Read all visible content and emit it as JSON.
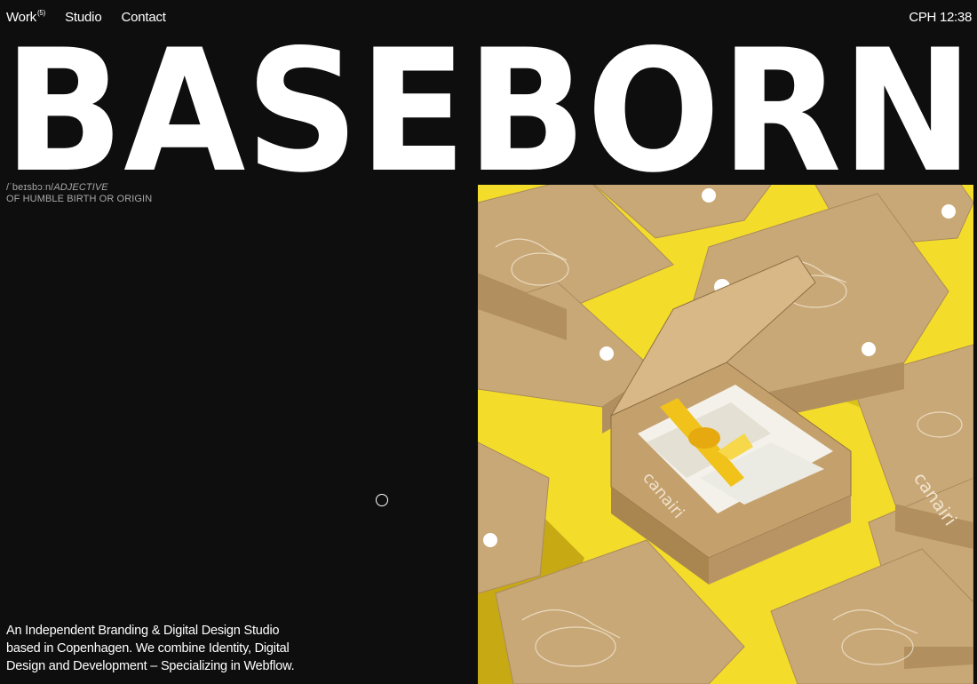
{
  "nav": {
    "items": [
      {
        "label": "Work",
        "sup": "(5)"
      },
      {
        "label": "Studio",
        "sup": ""
      },
      {
        "label": "Contact",
        "sup": ""
      }
    ],
    "clock": "CPH 12:38"
  },
  "hero": {
    "wordmark": "BASEBORN",
    "phonetic": "/ˈbeɪsbɔːn/",
    "part_of_speech": "ADJECTIVE",
    "definition": "OF HUMBLE BIRTH OR ORIGIN"
  },
  "intro": {
    "text": "An Independent Branding & Digital Design Studio based in Copenhagen. We combine Identity, Digital Design and Development – Specializing in Webflow."
  },
  "photo": {
    "brand_text": "canairi"
  },
  "colors": {
    "background": "#0e0e0e",
    "text": "#ffffff",
    "muted": "#a8a8a8",
    "photo_yellow": "#f4dc2a",
    "cardboard": "#c9a878"
  }
}
